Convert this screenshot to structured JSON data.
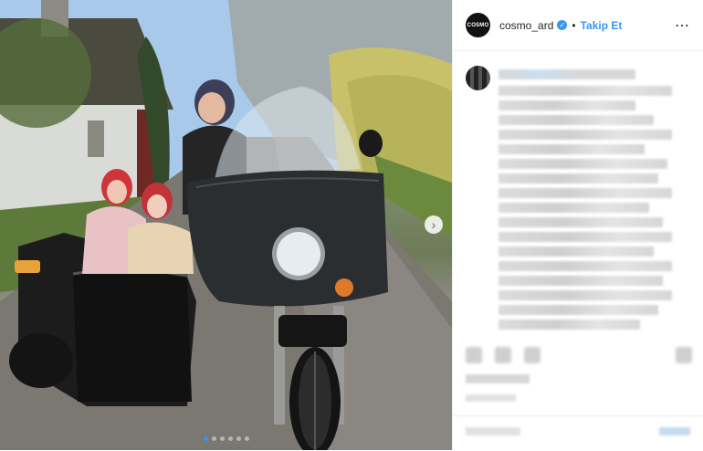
{
  "header": {
    "avatar_text": "COSMO",
    "username": "cosmo_ard",
    "separator": "•",
    "follow_label": "Takip Et",
    "more_icon": "⋯"
  },
  "photo": {
    "next_arrow": "›",
    "dots_count": 6,
    "active_dot": 0
  },
  "colors": {
    "accent": "#3897f0",
    "text": "#262626",
    "border": "#efefef"
  }
}
